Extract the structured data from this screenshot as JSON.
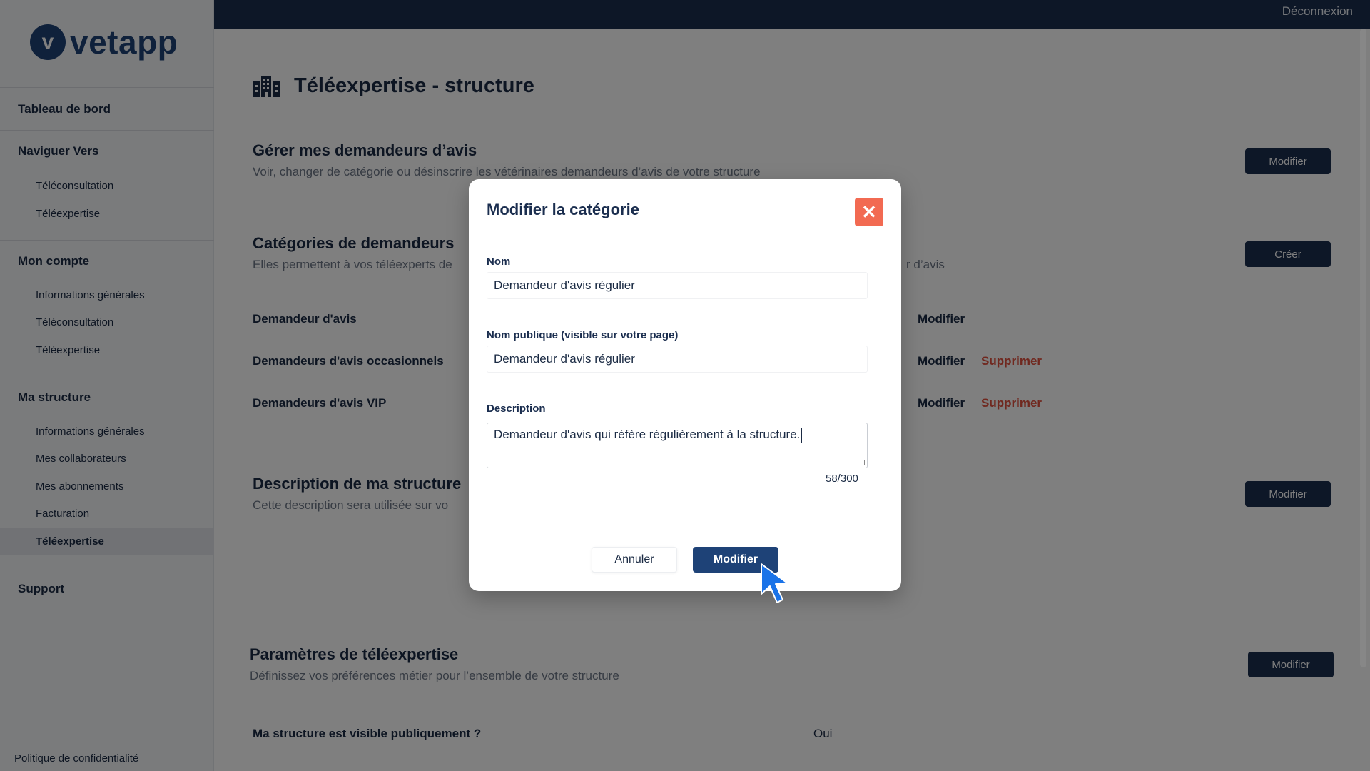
{
  "app": {
    "logo_text": "vetapp",
    "logo_mark": "v"
  },
  "topbar": {
    "logout_label": "Déconnexion"
  },
  "sidebar": {
    "dashboard": "Tableau de bord",
    "navigate_heading": "Naviguer Vers",
    "navigate_items": [
      "Téléconsultation",
      "Téléexpertise"
    ],
    "account_heading": "Mon compte",
    "account_items": [
      "Informations générales",
      "Téléconsultation",
      "Téléexpertise"
    ],
    "structure_heading": "Ma structure",
    "structure_items": [
      "Informations générales",
      "Mes collaborateurs",
      "Mes abonnements",
      "Facturation",
      "Téléexpertise"
    ],
    "active_item": "Téléexpertise",
    "support": "Support",
    "privacy": "Politique de confidentialité"
  },
  "main": {
    "page_title": "Téléexpertise - structure",
    "requesters": {
      "title": "Gérer mes demandeurs d’avis",
      "subtitle": "Voir, changer de catégorie ou désinscrire les vétérinaires demandeurs d’avis de votre structure",
      "button": "Modifier"
    },
    "categories": {
      "title": "Catégories de demandeurs",
      "subtitle_left": "Elles permettent à vos téléexperts de",
      "subtitle_right": "r d’avis",
      "button": "Créer",
      "rows": [
        {
          "name": "Demandeur d'avis",
          "edit": "Modifier"
        },
        {
          "name": "Demandeurs d'avis occasionnels",
          "edit": "Modifier",
          "delete": "Supprimer"
        },
        {
          "name": "Demandeurs d'avis VIP",
          "edit": "Modifier",
          "delete": "Supprimer"
        }
      ]
    },
    "description": {
      "title": "Description de ma structure",
      "subtitle": "Cette description sera utilisée sur vo",
      "button": "Modifier"
    },
    "settings": {
      "title": "Paramètres de téléexpertise",
      "subtitle": "Définissez vos préférences métier pour l’ensemble de votre structure",
      "button": "Modifier",
      "visible_label": "Ma structure est visible publiquement ?",
      "visible_value": "Oui"
    }
  },
  "modal": {
    "title": "Modifier la catégorie",
    "close_glyph": "✕",
    "name_label": "Nom",
    "name_value": "Demandeur d'avis régulier",
    "public_name_label": "Nom publique (visible sur votre page)",
    "public_name_value": "Demandeur d'avis régulier",
    "description_label": "Description",
    "description_value": "Demandeur d'avis qui réfère régulièrement à la structure.",
    "counter": "58/300",
    "cancel_label": "Annuler",
    "submit_label": "Modifier"
  },
  "colors": {
    "navy": "#1b2e4f",
    "brand": "#1e4277",
    "danger": "#e0513e",
    "close": "#f26a52",
    "cursor": "#1a73e8"
  }
}
